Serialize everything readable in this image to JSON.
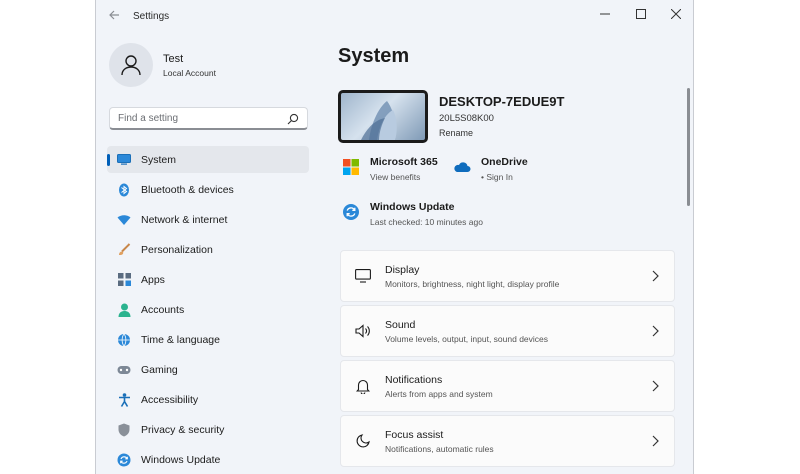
{
  "window": {
    "title": "Settings"
  },
  "profile": {
    "name": "Test",
    "account_type": "Local Account"
  },
  "search": {
    "placeholder": "Find a setting"
  },
  "sidebar": {
    "items": [
      {
        "label": "System",
        "icon": "system-icon",
        "active": true
      },
      {
        "label": "Bluetooth & devices",
        "icon": "bluetooth-icon"
      },
      {
        "label": "Network & internet",
        "icon": "wifi-icon"
      },
      {
        "label": "Personalization",
        "icon": "brush-icon"
      },
      {
        "label": "Apps",
        "icon": "apps-icon"
      },
      {
        "label": "Accounts",
        "icon": "person-icon"
      },
      {
        "label": "Time & language",
        "icon": "globe-clock-icon"
      },
      {
        "label": "Gaming",
        "icon": "gamepad-icon"
      },
      {
        "label": "Accessibility",
        "icon": "accessibility-icon"
      },
      {
        "label": "Privacy & security",
        "icon": "shield-icon"
      },
      {
        "label": "Windows Update",
        "icon": "update-icon"
      }
    ]
  },
  "main": {
    "title": "System",
    "device": {
      "name": "DESKTOP-7EDUE9T",
      "model": "20L5S08K00",
      "rename_label": "Rename"
    },
    "quick_links": {
      "microsoft365": {
        "title": "Microsoft 365",
        "subtitle": "View benefits"
      },
      "onedrive": {
        "title": "OneDrive",
        "subtitle": "• Sign In"
      },
      "windows_update": {
        "title": "Windows Update",
        "subtitle": "Last checked: 10 minutes ago"
      }
    },
    "cards": [
      {
        "title": "Display",
        "subtitle": "Monitors, brightness, night light, display profile",
        "icon": "display-icon"
      },
      {
        "title": "Sound",
        "subtitle": "Volume levels, output, input, sound devices",
        "icon": "speaker-icon"
      },
      {
        "title": "Notifications",
        "subtitle": "Alerts from apps and system",
        "icon": "bell-icon"
      },
      {
        "title": "Focus assist",
        "subtitle": "Notifications, automatic rules",
        "icon": "moon-icon"
      }
    ]
  },
  "colors": {
    "accent": "#005fb8",
    "background": "#f1f4f9",
    "card": "#fbfbfb"
  }
}
